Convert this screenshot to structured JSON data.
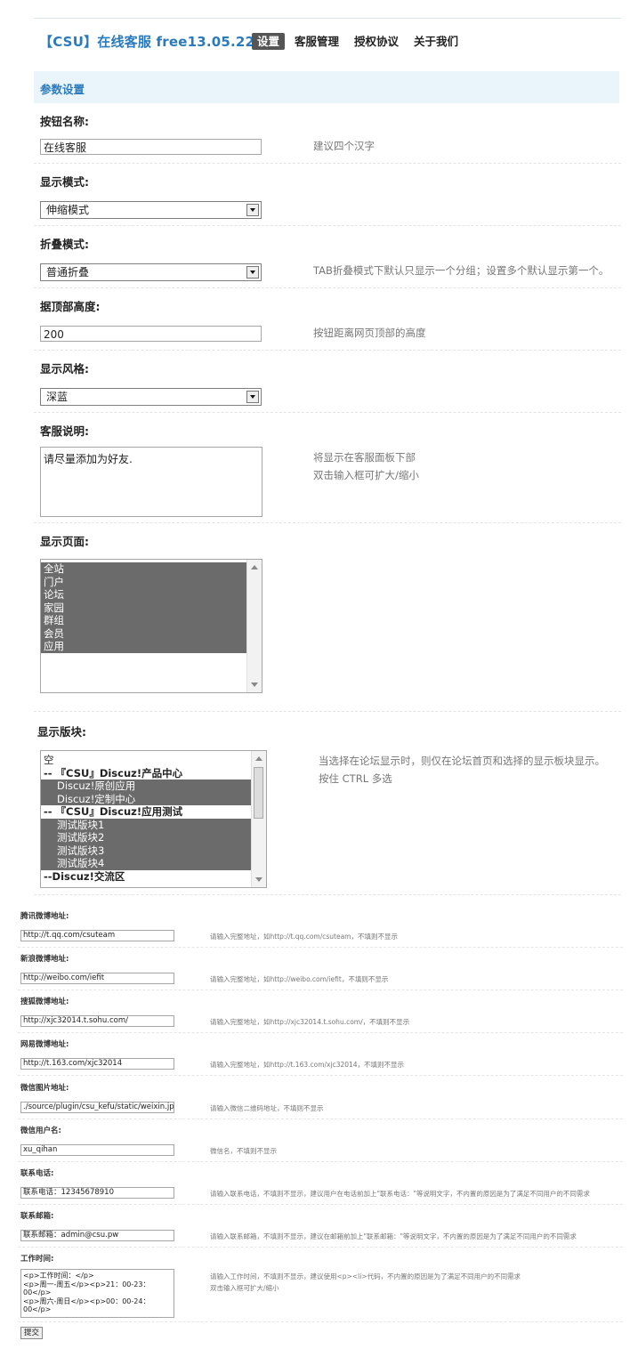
{
  "header": {
    "title": "【CSU】在线客服 free13.05.22",
    "tabs": [
      {
        "label": "设置",
        "active": true
      },
      {
        "label": "客服管理"
      },
      {
        "label": "授权协议"
      },
      {
        "label": "关于我们"
      }
    ]
  },
  "section_title": "参数设置",
  "fields": {
    "button_name": {
      "label": "按钮名称:",
      "value": "在线客服",
      "hint": "建议四个汉字"
    },
    "display_mode": {
      "label": "显示模式:",
      "value": "伸缩模式"
    },
    "fold_mode": {
      "label": "折叠模式:",
      "value": "普通折叠",
      "hint": "TAB折叠模式下默认只显示一个分组；设置多个默认显示第一个。"
    },
    "top_height": {
      "label": "据顶部高度:",
      "value": "200",
      "hint": "按钮距离网页顶部的高度"
    },
    "display_style": {
      "label": "显示风格:",
      "value": "深蓝"
    },
    "service_desc": {
      "label": "客服说明:",
      "value": "请尽量添加为好友.",
      "hint1": "将显示在客服面板下部",
      "hint2": "双击输入框可扩大/缩小"
    },
    "display_pages": {
      "label": "显示页面:",
      "options": [
        "全站",
        "门户",
        "论坛",
        "家园",
        "群组",
        "会员",
        "应用"
      ]
    },
    "display_forums": {
      "label": "显示版块:",
      "hint1": "当选择在论坛显示时，则仅在论坛首页和选择的显示板块显示。",
      "hint2": "按住 CTRL 多选",
      "options": [
        {
          "text": "空",
          "sel": false,
          "grp": false
        },
        {
          "text": "-- 『CSU』Discuz!产品中心",
          "sel": false,
          "grp": true
        },
        {
          "text": "Discuz!原创应用",
          "sel": true,
          "grp": false
        },
        {
          "text": "Discuz!定制中心",
          "sel": true,
          "grp": false
        },
        {
          "text": "-- 『CSU』Discuz!应用测试",
          "sel": false,
          "grp": true
        },
        {
          "text": "测试版块1",
          "sel": true,
          "grp": false
        },
        {
          "text": "测试版块2",
          "sel": true,
          "grp": false
        },
        {
          "text": "测试版块3",
          "sel": true,
          "grp": false
        },
        {
          "text": "测试版块4",
          "sel": true,
          "grp": false
        },
        {
          "text": "--Discuz!交流区",
          "sel": false,
          "grp": true
        }
      ]
    }
  },
  "small_fields": [
    {
      "label": "腾讯微博地址:",
      "value": "http://t.qq.com/csuteam",
      "hint": "请输入完整地址，如http://t.qq.com/csuteam，不填则不显示"
    },
    {
      "label": "新浪微博地址:",
      "value": "http://weibo.com/iefit",
      "hint": "请输入完整地址，如http://weibo.com/iefit，不填则不显示"
    },
    {
      "label": "搜狐微博地址:",
      "value": "http://xjc32014.t.sohu.com/",
      "hint": "请输入完整地址，如http://xjc32014.t.sohu.com/，不填则不显示"
    },
    {
      "label": "网易微博地址:",
      "value": "http://t.163.com/xjc32014",
      "hint": "请输入完整地址，如http://t.163.com/xjc32014，不填则不显示"
    },
    {
      "label": "微信图片地址:",
      "value": "./source/plugin/csu_kefu/static/weixin.jp",
      "hint": "请输入微信二维码地址，不填则不显示"
    },
    {
      "label": "微信用户名:",
      "value": "xu_qihan",
      "hint": "微信名，不填则不显示"
    },
    {
      "label": "联系电话:",
      "value": "联系电话：12345678910",
      "hint": "请输入联系电话，不填则不显示，建议用户在电话前加上\"联系电话：\"等说明文字，不内置的原因是为了满足不同用户的不同需求"
    },
    {
      "label": "联系邮箱:",
      "value": "联系邮箱：admin@csu.pw",
      "hint": "请输入联系邮箱，不填则不显示，建议在邮箱前加上\"联系邮箱：\"等说明文字，不内置的原因是为了满足不同用户的不同需求"
    }
  ],
  "work_time": {
    "label": "工作时间:",
    "value": "<p>工作时间：</p>\n<p>周一-周五</p><p>21：00-23：00</p>\n<p>周六-周日</p><p>00：00-24：00</p>",
    "hint1": "请输入工作时间，不填则不显示，建议使用<p><li>代码，不内置的原因是为了满足不同用户的不同需求",
    "hint2": "双击输入框可扩大/缩小"
  },
  "submit_label": "提交"
}
